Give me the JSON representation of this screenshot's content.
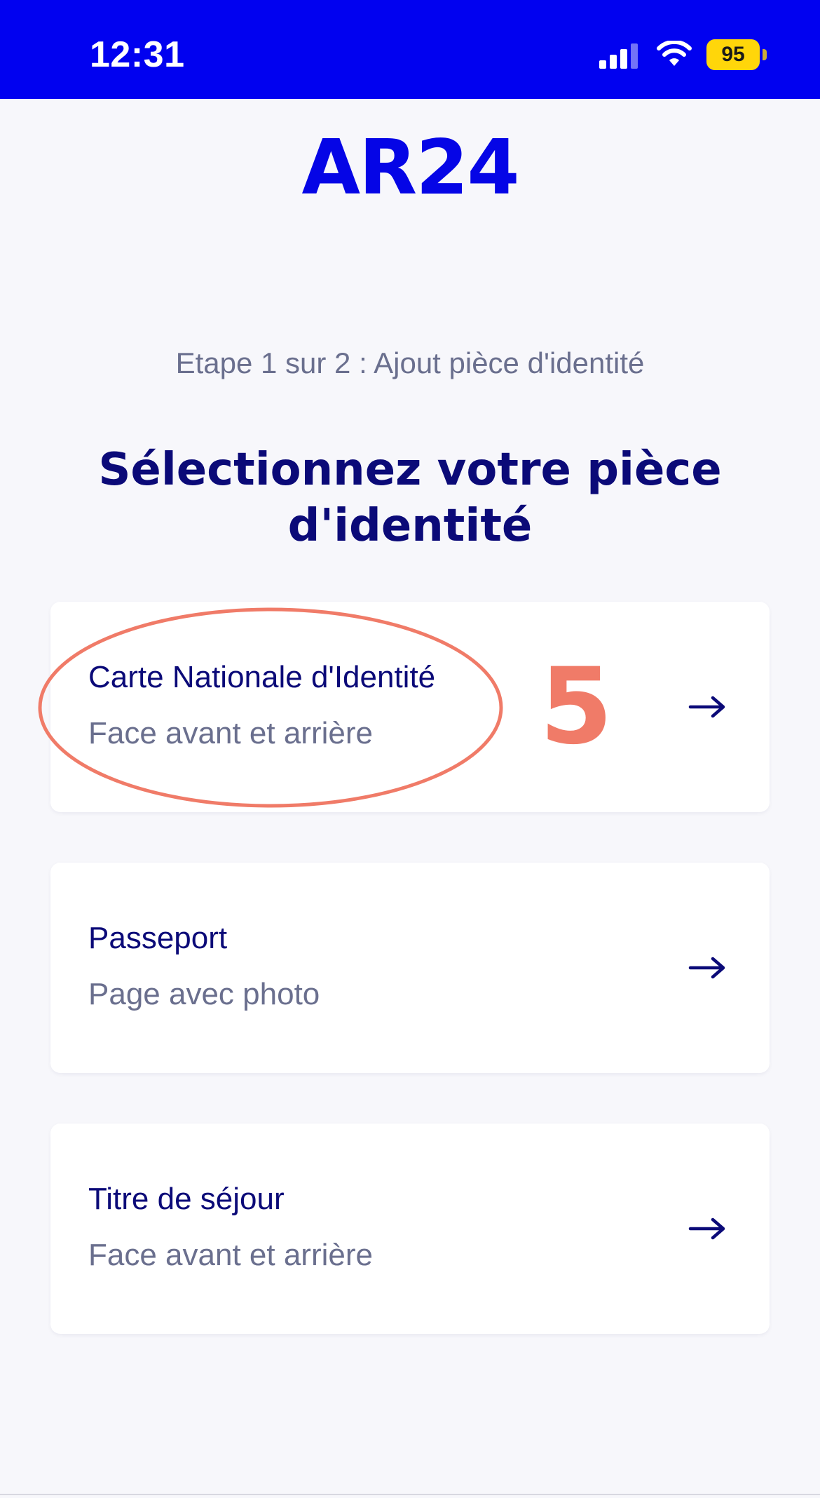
{
  "status_bar": {
    "time": "12:31",
    "battery_level": "95",
    "signal_icon": "cellular-signal-icon",
    "wifi_icon": "wifi-icon",
    "background_color": "#0101f0"
  },
  "header": {
    "logo_text": "AR24",
    "logo_color": "#0505e6"
  },
  "main": {
    "step_label": "Etape 1 sur 2 : Ajout pièce d'identité",
    "title": "Sélectionnez votre pièce d'identité",
    "options": [
      {
        "title": "Carte Nationale d'Identité",
        "subtitle": "Face avant et arrière",
        "arrow_icon": "arrow-right-icon"
      },
      {
        "title": "Passeport",
        "subtitle": "Page avec photo",
        "arrow_icon": "arrow-right-icon"
      },
      {
        "title": "Titre de séjour",
        "subtitle": "Face avant et arrière",
        "arrow_icon": "arrow-right-icon"
      }
    ]
  },
  "annotation": {
    "number": "5",
    "color": "#f07b68"
  },
  "colors": {
    "primary_text": "#0b0a78",
    "secondary_text": "#6a6f8e",
    "background": "#f7f7fb",
    "card_background": "#ffffff"
  }
}
